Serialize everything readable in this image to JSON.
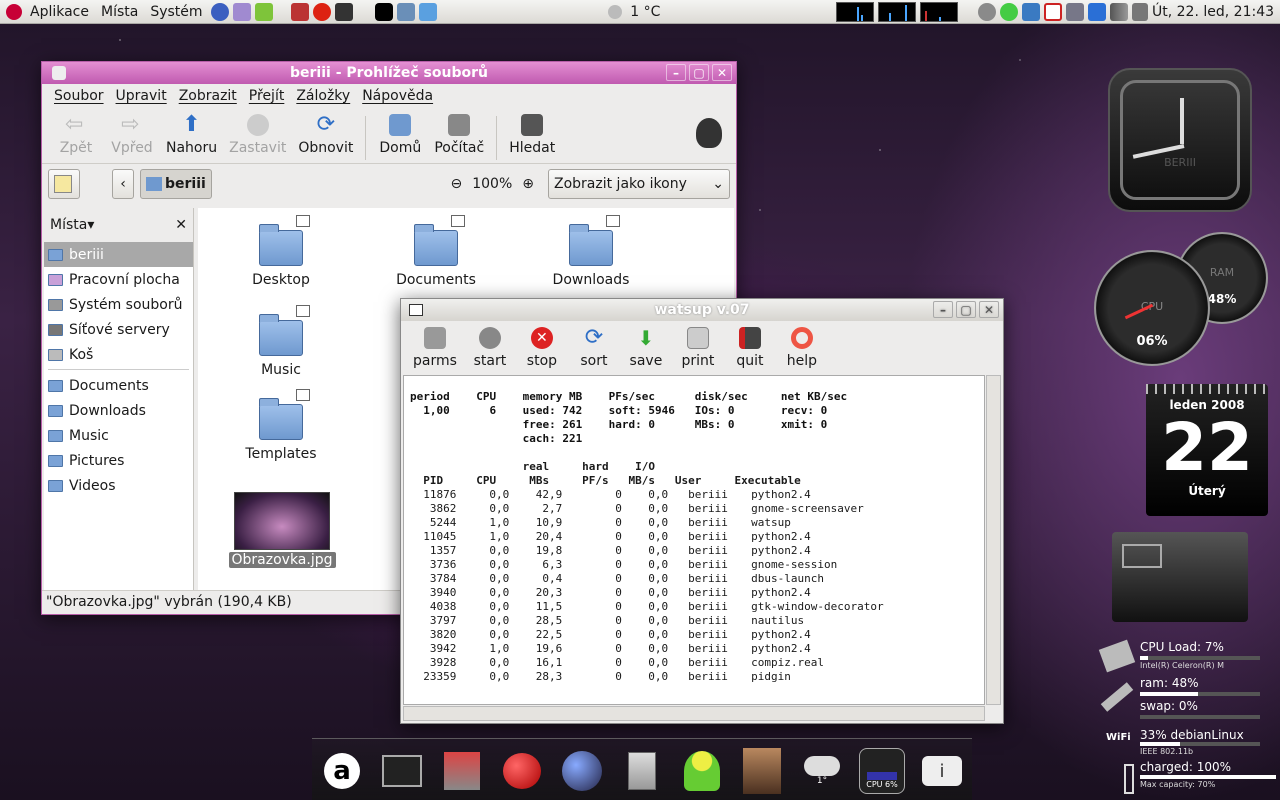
{
  "panel": {
    "menus": [
      "Aplikace",
      "Místa",
      "Systém"
    ],
    "weather": "1 °C",
    "datetime": "Út, 22. led, 21:43"
  },
  "nautilus": {
    "title": "beriii - Prohlížeč souborů",
    "menu": [
      "Soubor",
      "Upravit",
      "Zobrazit",
      "Přejít",
      "Záložky",
      "Nápověda"
    ],
    "toolbar": {
      "back": "Zpět",
      "forward": "Vpřed",
      "up": "Nahoru",
      "stop": "Zastavit",
      "reload": "Obnovit",
      "home": "Domů",
      "computer": "Počítač",
      "search": "Hledat"
    },
    "location": "beriii",
    "zoom": "100%",
    "view": "Zobrazit jako ikony",
    "places_label": "Místa",
    "places": [
      "beriii",
      "Pracovní plocha",
      "Systém souborů",
      "Síťové servery",
      "Koš"
    ],
    "bookmarks": [
      "Documents",
      "Downloads",
      "Music",
      "Pictures",
      "Videos"
    ],
    "files": [
      "Desktop",
      "Documents",
      "Downloads",
      "Music",
      "Templates",
      "Obrazovka.jpg"
    ],
    "status": "\"Obrazovka.jpg\" vybrán (190,4 KB)"
  },
  "watsup": {
    "title": "watsup v.07",
    "toolbar": [
      "parms",
      "start",
      "stop",
      "sort",
      "save",
      "print",
      "quit",
      "help"
    ],
    "summary": "period    CPU    memory MB    PFs/sec      disk/sec     net KB/sec\n  1,00      6    used: 742    soft: 5946   IOs: 0       recv: 0\n                 free: 261    hard: 0      MBs: 0       xmit: 0\n                 cach: 221",
    "table_head": "                 real     hard    I/O\n  PID     CPU     MBs     PF/s   MB/s   User     Executable",
    "rows": [
      [
        "11876",
        "0,0",
        "42,9",
        "0",
        "0,0",
        "beriii",
        "python2.4"
      ],
      [
        "3862",
        "0,0",
        "2,7",
        "0",
        "0,0",
        "beriii",
        "gnome-screensaver"
      ],
      [
        "5244",
        "1,0",
        "10,9",
        "0",
        "0,0",
        "beriii",
        "watsup"
      ],
      [
        "11045",
        "1,0",
        "20,4",
        "0",
        "0,0",
        "beriii",
        "python2.4"
      ],
      [
        "1357",
        "0,0",
        "19,8",
        "0",
        "0,0",
        "beriii",
        "python2.4"
      ],
      [
        "3736",
        "0,0",
        "6,3",
        "0",
        "0,0",
        "beriii",
        "gnome-session"
      ],
      [
        "3784",
        "0,0",
        "0,4",
        "0",
        "0,0",
        "beriii",
        "dbus-launch"
      ],
      [
        "3940",
        "0,0",
        "20,3",
        "0",
        "0,0",
        "beriii",
        "python2.4"
      ],
      [
        "4038",
        "0,0",
        "11,5",
        "0",
        "0,0",
        "beriii",
        "gtk-window-decorator"
      ],
      [
        "3797",
        "0,0",
        "28,5",
        "0",
        "0,0",
        "beriii",
        "nautilus"
      ],
      [
        "3820",
        "0,0",
        "22,5",
        "0",
        "0,0",
        "beriii",
        "python2.4"
      ],
      [
        "3942",
        "1,0",
        "19,6",
        "0",
        "0,0",
        "beriii",
        "python2.4"
      ],
      [
        "3928",
        "0,0",
        "16,1",
        "0",
        "0,0",
        "beriii",
        "compiz.real"
      ],
      [
        "23359",
        "0,0",
        "28,3",
        "0",
        "0,0",
        "beriii",
        "pidgin"
      ]
    ]
  },
  "widgets": {
    "clock_label": "BERIII",
    "cpu_gauge": "06%",
    "cpu_label": "CPU",
    "ram_gauge": "48%",
    "ram_label": "RAM",
    "calendar_month": "leden 2008",
    "calendar_day": "22",
    "calendar_weekday": "Úterý",
    "cpu_load": "CPU Load: 7%",
    "cpu_model": "Intel(R) Celeron(R) M",
    "ram": "ram: 48%",
    "swap": "swap: 0%",
    "wifi": "33%  debianLinux",
    "wifi_std": "IEEE 802.11b",
    "battery": "charged: 100%",
    "battery_cap": "Max capacity: 70%",
    "cpu_fill": 0.07,
    "ram_fill": 0.48,
    "wifi_fill": 0.33,
    "battery_fill": 1.0
  },
  "dock": {
    "weather_temp": "1°",
    "cpu_label": "CPU 6%"
  }
}
